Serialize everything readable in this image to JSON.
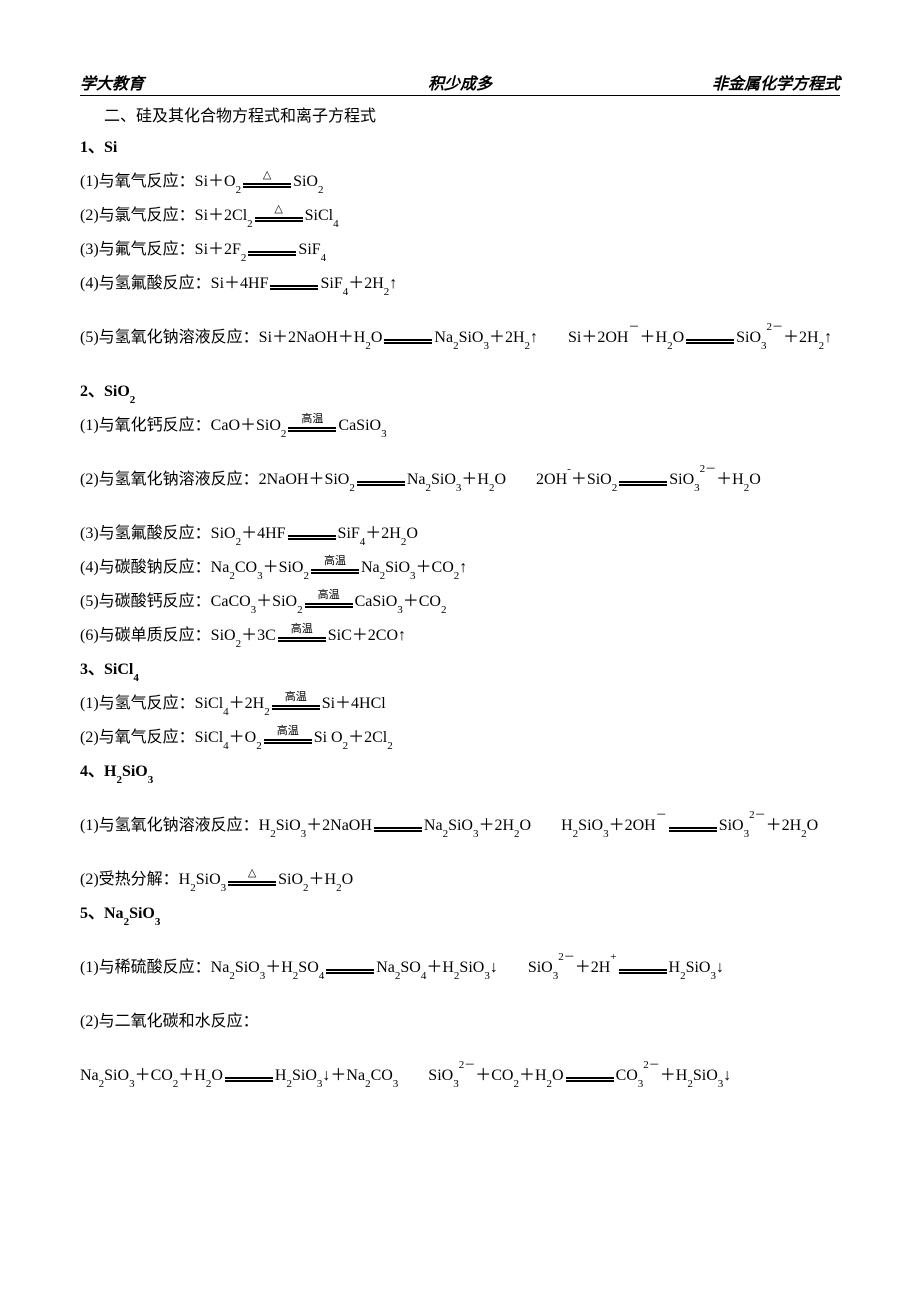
{
  "header": {
    "left": "学大教育",
    "center": "积少成多",
    "right": "非金属化学方程式"
  },
  "title": "二、硅及其化合物方程式和离子方程式",
  "conditions": {
    "triangle": "△",
    "high_temp": "高温",
    "none": ""
  },
  "sections": [
    {
      "heading": "1、Si",
      "lines": [
        {
          "label": "(1)与氧气反应：",
          "lhs": "Si＋O<sub>2</sub>",
          "cond": "triangle",
          "rhs": "SiO<sub>2</sub>"
        },
        {
          "label": "(2)与氯气反应：",
          "lhs": "Si＋2Cl<sub>2</sub>",
          "cond": "triangle",
          "rhs": "SiCl<sub>4</sub>"
        },
        {
          "label": "(3)与氟气反应：",
          "lhs": "Si＋2F<sub>2</sub>",
          "cond": "none",
          "rhs": "SiF<sub>4</sub>"
        },
        {
          "label": "(4)与氢氟酸反应：",
          "lhs": "Si＋4HF",
          "cond": "none",
          "rhs": "SiF<sub>4</sub>＋2H<sub>2</sub>↑",
          "gap_after": true
        },
        {
          "label": "(5)与氢氧化钠溶液反应：",
          "lhs": "Si＋2NaOH＋H<sub>2</sub>O",
          "cond": "none",
          "rhs": "Na<sub>2</sub>SiO<sub>3</sub>＋2H<sub>2</sub>↑",
          "second": {
            "lhs": "Si＋2OH<sup>－</sup>＋H<sub>2</sub>O",
            "cond": "none",
            "rhs": "SiO<sub>3</sub><sup>2－</sup>＋2H<sub>2</sub>↑"
          },
          "gap_after": true
        }
      ]
    },
    {
      "heading": "2、SiO<sub>2</sub>",
      "lines": [
        {
          "label": "(1)与氧化钙反应：",
          "lhs": "CaO＋SiO<sub>2</sub>",
          "cond": "high_temp",
          "rhs": "CaSiO<sub>3</sub>",
          "gap_after": true
        },
        {
          "label": "(2)与氢氧化钠溶液反应：",
          "lhs": "2NaOH＋SiO<sub>2</sub>",
          "cond": "none",
          "rhs": "Na<sub>2</sub>SiO<sub>3</sub>＋H<sub>2</sub>O",
          "second": {
            "lhs": "2OH<sup>-</sup>＋SiO<sub>2</sub>",
            "cond": "none",
            "rhs": "SiO<sub>3</sub><sup>2－</sup>＋H<sub>2</sub>O"
          },
          "gap_after": true
        },
        {
          "label": "(3)与氢氟酸反应：",
          "lhs": "SiO<sub>2</sub>＋4HF",
          "cond": "none",
          "rhs": "SiF<sub>4</sub>＋2H<sub>2</sub>O"
        },
        {
          "label": "(4)与碳酸钠反应：",
          "lhs": "Na<sub>2</sub>CO<sub>3</sub>＋SiO<sub>2</sub>",
          "cond": "high_temp",
          "rhs": "Na<sub>2</sub>SiO<sub>3</sub>＋CO<sub>2</sub>↑"
        },
        {
          "label": "(5)与碳酸钙反应：",
          "lhs": "CaCO<sub>3</sub>＋SiO<sub>2</sub>",
          "cond": "high_temp",
          "rhs": "CaSiO<sub>3</sub>＋CO<sub>2</sub>"
        },
        {
          "label": "(6)与碳单质反应：",
          "lhs": "SiO<sub>2</sub>＋3C",
          "cond": "high_temp",
          "rhs": "SiC＋2CO↑"
        }
      ]
    },
    {
      "heading": "3、SiCl<sub>4</sub>",
      "lines": [
        {
          "label": "(1)与氢气反应：",
          "lhs": "SiCl<sub>4</sub>＋2H<sub>2</sub>",
          "cond": "high_temp",
          "rhs": "Si＋4HCl"
        },
        {
          "label": "(2)与氧气反应：",
          "lhs": "SiCl<sub>4</sub>＋O<sub>2</sub>",
          "cond": "high_temp",
          "rhs": "Si O<sub>2</sub>＋2Cl<sub>2</sub>"
        }
      ]
    },
    {
      "heading": "4、H<sub>2</sub>SiO<sub>3</sub>",
      "pre_gap": true,
      "lines": [
        {
          "label": "(1)与氢氧化钠溶液反应：",
          "lhs": "H<sub>2</sub>SiO<sub>3</sub>＋2NaOH",
          "cond": "none",
          "rhs": "Na<sub>2</sub>SiO<sub>3</sub>＋2H<sub>2</sub>O",
          "second": {
            "lhs": "H<sub>2</sub>SiO<sub>3</sub>＋2OH<sup>－</sup>",
            "cond": "none",
            "rhs": "SiO<sub>3</sub><sup>2－</sup>＋2H<sub>2</sub>O"
          },
          "gap_after": true
        },
        {
          "label": "(2)受热分解：",
          "lhs": "H<sub>2</sub>SiO<sub>3</sub>",
          "cond": "triangle",
          "rhs": "SiO<sub>2</sub>＋H<sub>2</sub>O"
        }
      ]
    },
    {
      "heading": "5、Na<sub>2</sub>SiO<sub>3</sub>",
      "pre_gap": true,
      "lines": [
        {
          "label": "(1)与稀硫酸反应：",
          "lhs": "Na<sub>2</sub>SiO<sub>3</sub>＋H<sub>2</sub>SO<sub>4</sub>",
          "cond": "none",
          "rhs": "Na<sub>2</sub>SO<sub>4</sub>＋H<sub>2</sub>SiO<sub>3</sub>↓",
          "second": {
            "lhs": "SiO<sub>3</sub><sup>2－</sup>＋2H<sup>+</sup>",
            "cond": "none",
            "rhs": "H<sub>2</sub>SiO<sub>3</sub>↓"
          },
          "gap_after": true
        },
        {
          "label": "(2)与二氧化碳和水反应：",
          "plain": true,
          "gap_after": true
        },
        {
          "label": "",
          "lhs": "Na<sub>2</sub>SiO<sub>3</sub>＋CO<sub>2</sub>＋H<sub>2</sub>O",
          "cond": "none",
          "rhs": "H<sub>2</sub>SiO<sub>3</sub>↓＋Na<sub>2</sub>CO<sub>3</sub>",
          "second": {
            "lhs": "SiO<sub>3</sub><sup>2－</sup>＋CO<sub>2</sub>＋H<sub>2</sub>O",
            "cond": "none",
            "rhs": "CO<sub>3</sub><sup>2－</sup>＋H<sub>2</sub>SiO<sub>3</sub>↓"
          }
        }
      ]
    }
  ]
}
